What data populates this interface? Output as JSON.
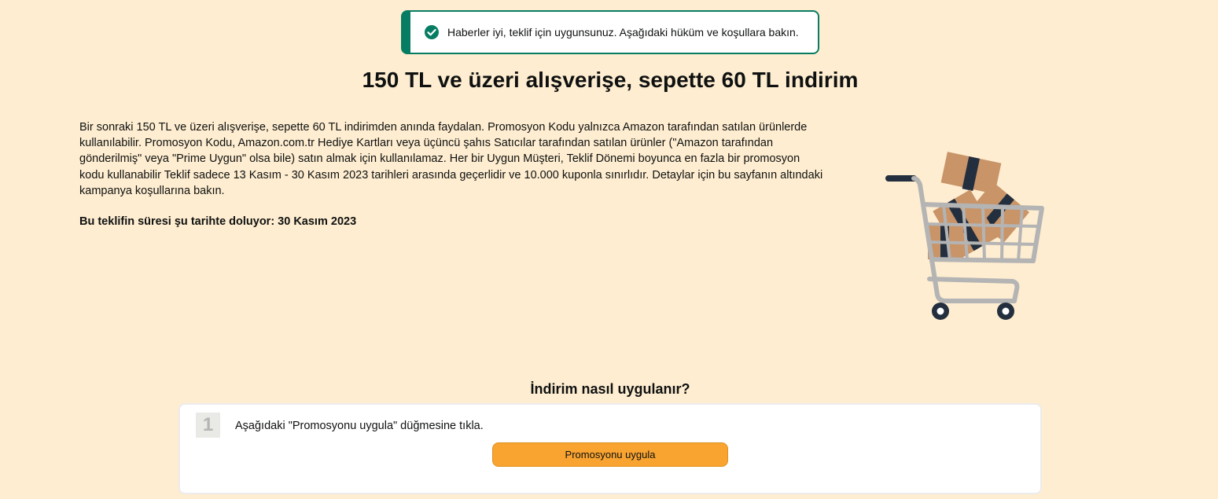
{
  "notice": {
    "icon": "check-circle-icon",
    "color": "#067d62",
    "text": "Haberler iyi, teklif için uygunsunuz. Aşağıdaki hüküm ve koşullara bakın."
  },
  "page": {
    "title": "150 TL ve üzeri alışverişe, sepette 60 TL indirim",
    "description": "Bir sonraki 150 TL ve üzeri alışverişe, sepette 60 TL indirimden anında faydalan. Promosyon Kodu yalnızca Amazon tarafından satılan ürünlerde kullanılabilir. Promosyon Kodu, Amazon.com.tr Hediye Kartları veya üçüncü şahıs Satıcılar tarafından satılan ürünler (\"Amazon tarafından gönderilmiş\" veya \"Prime Uygun\" olsa bile) satın almak için kullanılamaz. Her bir Uygun Müşteri, Teklif Dönemi boyunca en fazla bir promosyon kodu kullanabilir Teklif sadece 13 Kasım - 30 Kasım 2023 tarihleri arasında geçerlidir ve 10.000 kuponla sınırlıdır. Detaylar için bu sayfanın altındaki kampanya koşullarına bakın.",
    "expiry": "Bu teklifin süresi şu tarihte doluyor: 30 Kasım 2023",
    "illustration": "shopping-cart-with-boxes"
  },
  "how_to": {
    "title": "İndirim nasıl uygulanır?",
    "steps": [
      {
        "number": "1",
        "text": "Aşağıdaki \"Promosyonu uygula\" düğmesine tıkla.",
        "button_label": "Promosyonu uygula"
      }
    ]
  },
  "colors": {
    "background": "#feedd0",
    "accent": "#067d62",
    "button": "#f9a431"
  }
}
